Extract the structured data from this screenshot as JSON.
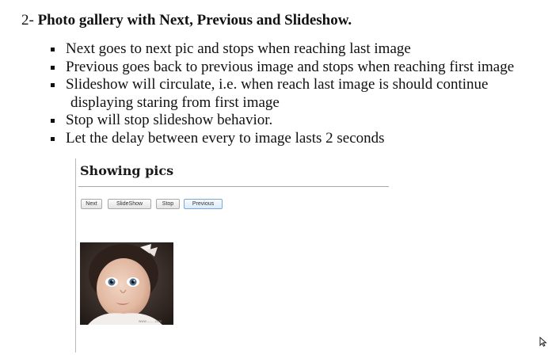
{
  "heading": {
    "number": "2-",
    "title": "Photo gallery with Next, Previous and Slideshow."
  },
  "requirements": [
    {
      "line": "Next goes to next pic and stops when reaching last image"
    },
    {
      "line": "Previous goes back to previous image and stops when reaching first image"
    },
    {
      "line": "Slideshow will circulate, i.e. when reach last image is should continue",
      "continuation": "displaying staring from first image"
    },
    {
      "line": "Stop will stop slideshow behavior."
    },
    {
      "line": "Let the delay between every to image lasts 2 seconds"
    }
  ],
  "demo": {
    "title": "Showing pics",
    "buttons": {
      "next": "Next",
      "slideshow": "SlideShow",
      "stop": "Stop",
      "previous": "Previous"
    },
    "image": {
      "subject": "baby portrait",
      "watermark": "www.........com"
    }
  },
  "colors": {
    "text": "#111111",
    "focused_button_border": "#7aa8d8",
    "rule": "#a8a8a8"
  },
  "icons": {
    "cursor": "mouse-pointer-icon"
  }
}
